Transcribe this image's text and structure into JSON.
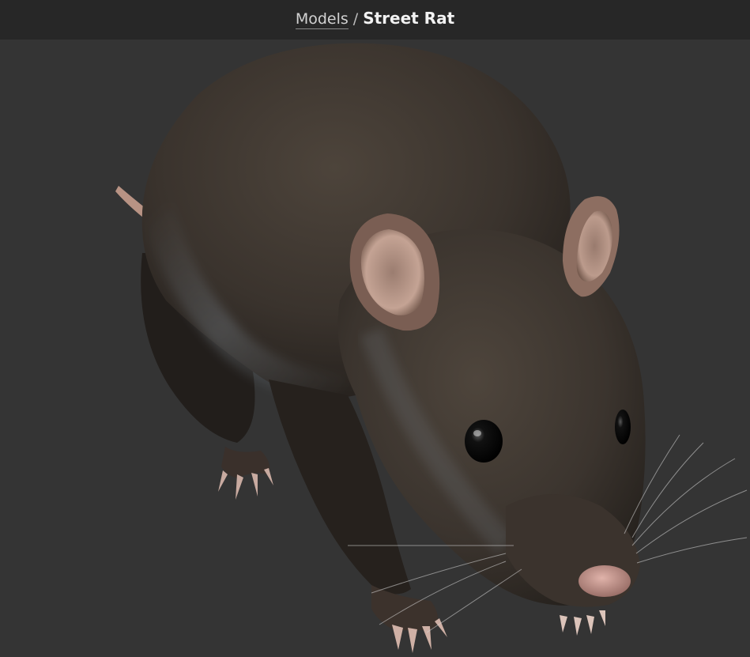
{
  "header": {
    "breadcrumb_parent": "Models",
    "separator": "/",
    "breadcrumb_current": "Street Rat"
  },
  "viewport": {
    "background_color": "#343434",
    "subject": "rat-3d-model"
  },
  "colors": {
    "topbar": "#272727",
    "fur_dark": "#2b2622",
    "fur_mid": "#4a4139",
    "skin_pink": "#b8948a"
  }
}
